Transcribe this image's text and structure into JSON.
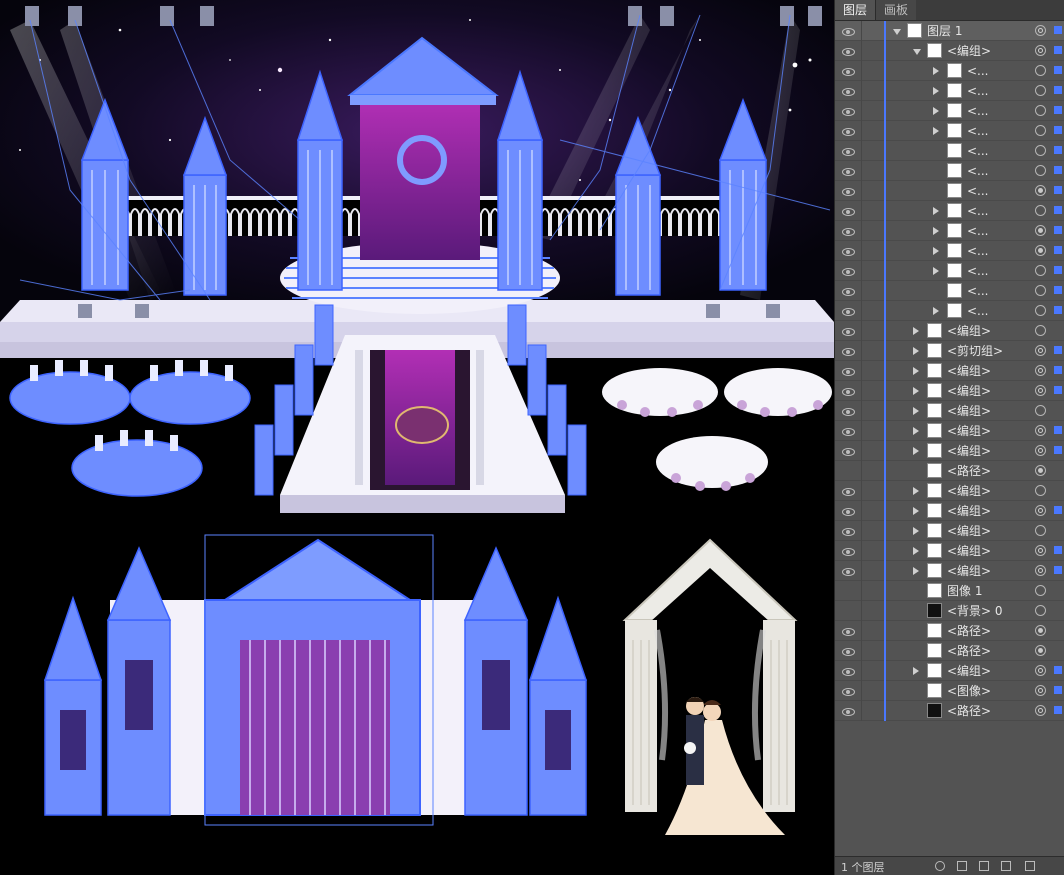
{
  "panel": {
    "tabs": [
      {
        "label": "图层"
      },
      {
        "label": "画板"
      }
    ],
    "footer_count": "1 个图层",
    "accent": "#4a78ff",
    "rows": [
      {
        "label": "图层 1",
        "indent": 0,
        "arrow": "down",
        "eye": true,
        "thumb": "white",
        "target": "filled",
        "sel": true
      },
      {
        "label": "<编组>",
        "indent": 1,
        "arrow": "down",
        "eye": true,
        "thumb": "white",
        "target": "filled",
        "sel": true
      },
      {
        "label": "<...",
        "indent": 2,
        "arrow": "right",
        "eye": true,
        "thumb": "white",
        "target": "ring",
        "sel": true
      },
      {
        "label": "<...",
        "indent": 2,
        "arrow": "right",
        "eye": true,
        "thumb": "white",
        "target": "ring",
        "sel": true
      },
      {
        "label": "<...",
        "indent": 2,
        "arrow": "right",
        "eye": true,
        "thumb": "white",
        "target": "ring",
        "sel": true
      },
      {
        "label": "<...",
        "indent": 2,
        "arrow": "right",
        "eye": true,
        "thumb": "white",
        "target": "ring",
        "sel": true
      },
      {
        "label": "<...",
        "indent": 2,
        "arrow": "none",
        "eye": true,
        "thumb": "white",
        "target": "ring",
        "sel": true
      },
      {
        "label": "<...",
        "indent": 2,
        "arrow": "none",
        "eye": true,
        "thumb": "white",
        "target": "ring",
        "sel": true
      },
      {
        "label": "<...",
        "indent": 2,
        "arrow": "none",
        "eye": true,
        "thumb": "white",
        "target": "dot",
        "sel": true
      },
      {
        "label": "<...",
        "indent": 2,
        "arrow": "right",
        "eye": true,
        "thumb": "white",
        "target": "ring",
        "sel": true
      },
      {
        "label": "<...",
        "indent": 2,
        "arrow": "right",
        "eye": true,
        "thumb": "white",
        "target": "dot",
        "sel": true
      },
      {
        "label": "<...",
        "indent": 2,
        "arrow": "right",
        "eye": true,
        "thumb": "white",
        "target": "dot",
        "sel": true
      },
      {
        "label": "<...",
        "indent": 2,
        "arrow": "right",
        "eye": true,
        "thumb": "white",
        "target": "ring",
        "sel": true
      },
      {
        "label": "<...",
        "indent": 2,
        "arrow": "none",
        "eye": true,
        "thumb": "white",
        "target": "ring",
        "sel": true
      },
      {
        "label": "<...",
        "indent": 2,
        "arrow": "right",
        "eye": true,
        "thumb": "white",
        "target": "ring",
        "sel": true
      },
      {
        "label": "<编组>",
        "indent": 1,
        "arrow": "right",
        "eye": true,
        "thumb": "white",
        "target": "ring",
        "sel": false
      },
      {
        "label": "<剪切组>",
        "indent": 1,
        "arrow": "right",
        "eye": true,
        "thumb": "white",
        "target": "filled",
        "sel": true
      },
      {
        "label": "<编组>",
        "indent": 1,
        "arrow": "right",
        "eye": true,
        "thumb": "white",
        "target": "filled",
        "sel": true
      },
      {
        "label": "<编组>",
        "indent": 1,
        "arrow": "right",
        "eye": true,
        "thumb": "white",
        "target": "filled",
        "sel": true
      },
      {
        "label": "<编组>",
        "indent": 1,
        "arrow": "right",
        "eye": true,
        "thumb": "white",
        "target": "ring",
        "sel": false
      },
      {
        "label": "<编组>",
        "indent": 1,
        "arrow": "right",
        "eye": true,
        "thumb": "white",
        "target": "filled",
        "sel": true
      },
      {
        "label": "<编组>",
        "indent": 1,
        "arrow": "right",
        "eye": true,
        "thumb": "white",
        "target": "filled",
        "sel": true
      },
      {
        "label": "<路径>",
        "indent": 1,
        "arrow": "none",
        "eye": false,
        "thumb": "white",
        "target": "dot",
        "sel": false
      },
      {
        "label": "<编组>",
        "indent": 1,
        "arrow": "right",
        "eye": true,
        "thumb": "white",
        "target": "ring",
        "sel": false
      },
      {
        "label": "<编组>",
        "indent": 1,
        "arrow": "right",
        "eye": true,
        "thumb": "white",
        "target": "filled",
        "sel": true
      },
      {
        "label": "<编组>",
        "indent": 1,
        "arrow": "right",
        "eye": true,
        "thumb": "white",
        "target": "ring",
        "sel": false
      },
      {
        "label": "<编组>",
        "indent": 1,
        "arrow": "right",
        "eye": true,
        "thumb": "white",
        "target": "filled",
        "sel": true
      },
      {
        "label": "<编组>",
        "indent": 1,
        "arrow": "right",
        "eye": true,
        "thumb": "white",
        "target": "filled",
        "sel": true
      },
      {
        "label": "图像 1",
        "indent": 1,
        "arrow": "none",
        "eye": false,
        "thumb": "white",
        "target": "ring",
        "sel": false
      },
      {
        "label": "<背景> 0",
        "indent": 1,
        "arrow": "none",
        "eye": false,
        "thumb": "dark",
        "target": "ring",
        "sel": false
      },
      {
        "label": "<路径>",
        "indent": 1,
        "arrow": "none",
        "eye": true,
        "thumb": "white",
        "target": "dot",
        "sel": false
      },
      {
        "label": "<路径>",
        "indent": 1,
        "arrow": "none",
        "eye": true,
        "thumb": "white",
        "target": "dot",
        "sel": false
      },
      {
        "label": "<编组>",
        "indent": 1,
        "arrow": "right",
        "eye": true,
        "thumb": "white",
        "target": "filled",
        "sel": true
      },
      {
        "label": "<图像>",
        "indent": 1,
        "arrow": "none",
        "eye": true,
        "thumb": "white",
        "target": "filled",
        "sel": true
      },
      {
        "label": "<路径>",
        "indent": 1,
        "arrow": "none",
        "eye": true,
        "thumb": "dark",
        "target": "filled",
        "sel": true
      }
    ]
  }
}
